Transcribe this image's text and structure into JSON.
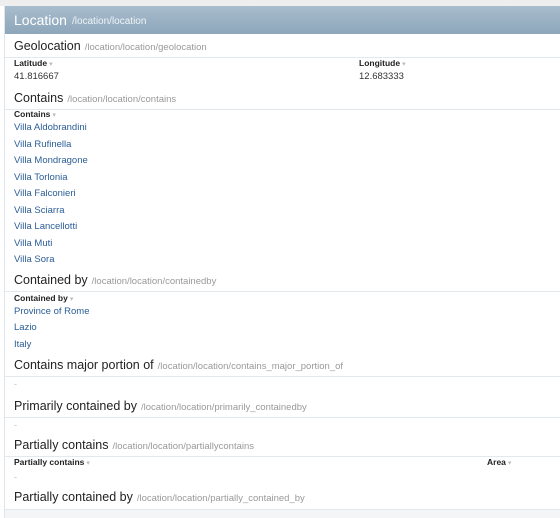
{
  "header": {
    "title": "Location",
    "path": "/location/location"
  },
  "geolocation": {
    "title": "Geolocation",
    "path": "/location/location/geolocation",
    "col_latitude": "Latitude",
    "col_longitude": "Longitude",
    "latitude": "41.816667",
    "longitude": "12.683333"
  },
  "contains": {
    "title": "Contains",
    "path": "/location/location/contains",
    "col": "Contains",
    "items": [
      "Villa Aldobrandini",
      "Villa Rufinella",
      "Villa Mondragone",
      "Villa Torlonia",
      "Villa Falconieri",
      "Villa Sciarra",
      "Villa Lancellotti",
      "Villa Muti",
      "Villa Sora"
    ]
  },
  "containedby": {
    "title": "Contained by",
    "path": "/location/location/containedby",
    "col": "Contained by",
    "items": [
      "Province of Rome",
      "Lazio",
      "Italy"
    ]
  },
  "major_portion": {
    "title": "Contains major portion of",
    "path": "/location/location/contains_major_portion_of",
    "empty": "-"
  },
  "primarily": {
    "title": "Primarily contained by",
    "path": "/location/location/primarily_containedby",
    "empty": "-"
  },
  "partially_contains": {
    "title": "Partially contains",
    "path": "/location/location/partiallycontains",
    "col_partial": "Partially contains",
    "col_area": "Area",
    "empty": "-"
  },
  "partially_contained_by": {
    "title": "Partially contained by",
    "path": "/location/location/partially_contained_by"
  },
  "sort_caret": "▾",
  "colors": {
    "header": "#97afc2",
    "link": "#2a5d96"
  }
}
